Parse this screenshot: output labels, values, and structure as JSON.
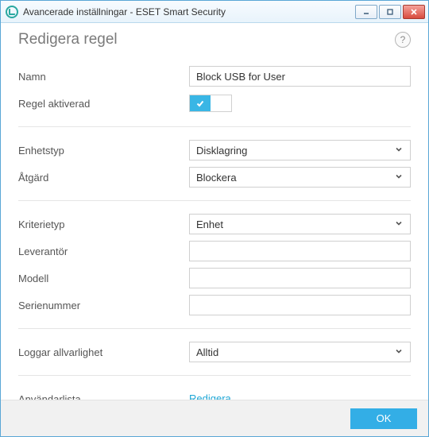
{
  "window": {
    "title": "Avancerade inställningar - ESET Smart Security"
  },
  "page": {
    "title": "Redigera regel",
    "help_tooltip": "?"
  },
  "fields": {
    "name_label": "Namn",
    "name_value": "Block USB for User",
    "enabled_label": "Regel aktiverad",
    "enabled_value": true,
    "device_type_label": "Enhetstyp",
    "device_type_value": "Disklagring",
    "action_label": "Åtgärd",
    "action_value": "Blockera",
    "criteria_type_label": "Kriterietyp",
    "criteria_type_value": "Enhet",
    "vendor_label": "Leverantör",
    "vendor_value": "",
    "model_label": "Modell",
    "model_value": "",
    "serial_label": "Serienummer",
    "serial_value": "",
    "log_severity_label": "Loggar allvarlighet",
    "log_severity_value": "Alltid",
    "user_list_label": "Användarlista",
    "user_list_link": "Redigera"
  },
  "footer": {
    "ok_label": "OK"
  }
}
